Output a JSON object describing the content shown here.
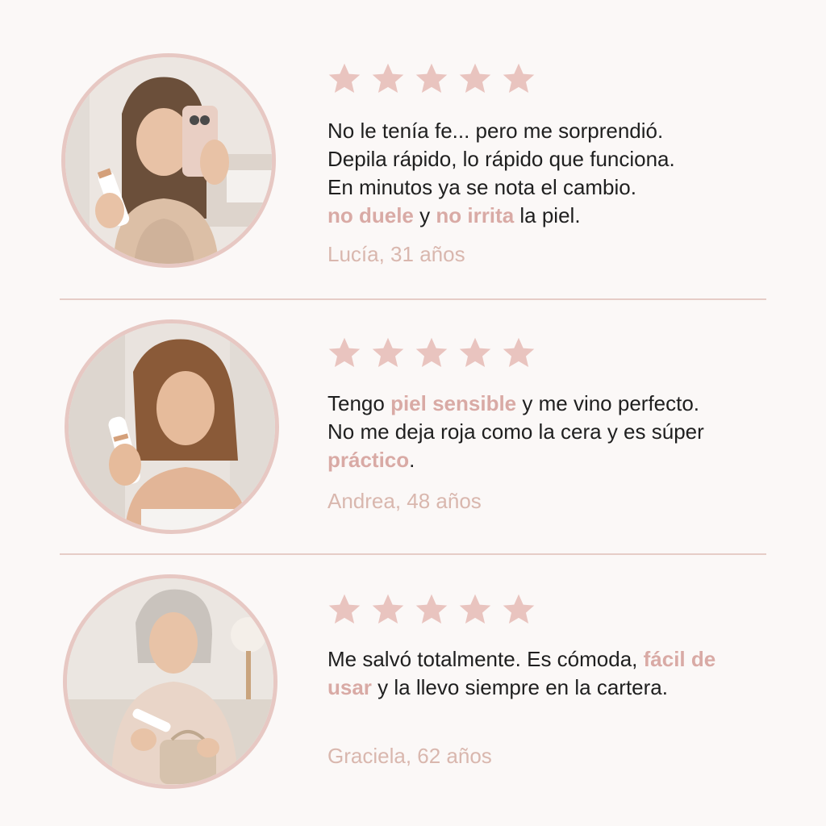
{
  "colors": {
    "background": "#fbf8f7",
    "accent": "#d9aaa5",
    "star": "#e9c4bf",
    "author": "#d9b7ae",
    "text": "#1f1f1f",
    "divider": "#e6cdc7"
  },
  "reviews": [
    {
      "rating": 5,
      "text_parts": [
        {
          "text": "No le tenía fe... pero me sorprendió.",
          "highlight": false
        },
        {
          "text": "Depila rápido, lo rápido que funciona.",
          "highlight": false
        },
        {
          "text": "En minutos ya se nota el cambio.",
          "highlight": false
        },
        {
          "text": "no duele",
          "highlight": true
        },
        {
          "text": " y ",
          "highlight": false
        },
        {
          "text": "no irrita",
          "highlight": true
        },
        {
          "text": " la piel.",
          "highlight": false
        }
      ],
      "author": "Lucía, 31 años",
      "photo_icon": "woman-selfie-photo"
    },
    {
      "rating": 5,
      "text_parts": [
        {
          "text": "Tengo ",
          "highlight": false
        },
        {
          "text": "piel sensible",
          "highlight": true
        },
        {
          "text": " y me vino perfecto. No me deja roja como la cera y es súper ",
          "highlight": false
        },
        {
          "text": "práctico",
          "highlight": true
        },
        {
          "text": ".",
          "highlight": false
        }
      ],
      "author": "Andrea, 48 años",
      "photo_icon": "woman-holding-device-photo"
    },
    {
      "rating": 5,
      "text_parts": [
        {
          "text": "Me salvó totalmente. Es cómoda, ",
          "highlight": false
        },
        {
          "text": "fácil de usar",
          "highlight": true
        },
        {
          "text": " y la llevo siempre en la cartera.",
          "highlight": false
        }
      ],
      "author": "Graciela, 62 años",
      "photo_icon": "senior-woman-with-bag-photo"
    }
  ]
}
